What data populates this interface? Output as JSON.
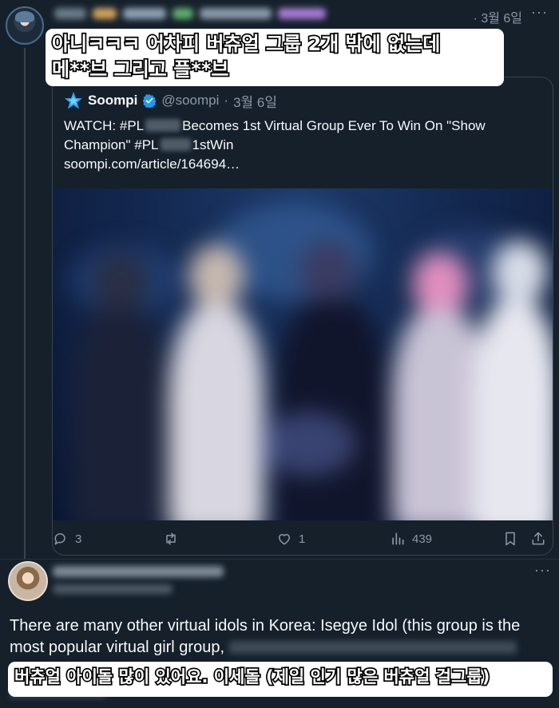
{
  "tweet": {
    "date": "3월 6일",
    "more_icon": "more-dots-icon",
    "caption": "아니ㅋㅋㅋ 어차피 버츄얼 그룹 2개 밖에 없는데\n메**브 그리고 플**브"
  },
  "quote": {
    "name": "Soompi",
    "handle": "@soompi",
    "separator": "·",
    "date": "3월 6일",
    "text_line1_a": "WATCH: #PL",
    "text_line1_b": "Becomes 1st Virtual Group Ever To Win On \"Show",
    "text_line2_a": "Champion\" #PL",
    "text_line2_b": "1stWin",
    "link": "soompi.com/article/164694…",
    "icons": [
      "soompi-star-icon",
      "verified-badge-icon"
    ]
  },
  "actions": {
    "replies": "3",
    "retweets": "",
    "likes": "1",
    "views": "439",
    "icons": [
      "reply-icon",
      "retweet-icon",
      "like-icon",
      "views-icon",
      "bookmark-icon",
      "share-icon"
    ]
  },
  "reply": {
    "text_a": "There are many other virtual idols in Korea: Isegye Idol (this group is the most popular virtual girl group,",
    "caption": "버츄얼 아이돌 많이 있어요. 이세돌 (제일 인기 많은 버츄얼 걸그룹)"
  },
  "colors": {
    "background": "#15202b",
    "border": "#38444d",
    "muted_text": "#8b98a5",
    "verified": "#1d9bf0"
  }
}
